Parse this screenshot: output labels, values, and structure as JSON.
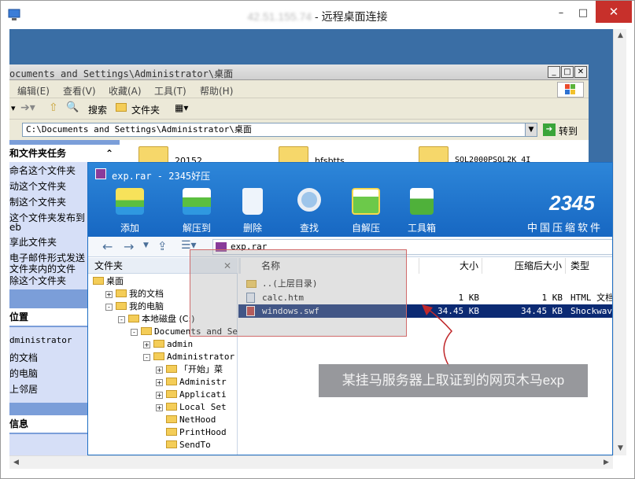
{
  "rdp": {
    "title_blurred": "42.51.155.74",
    "title_sep": " - ",
    "title": "远程桌面连接",
    "minimize": "–",
    "maximize": "□",
    "close": "✕"
  },
  "explorer": {
    "title": "ocuments and Settings\\Administrator\\桌面",
    "menu": [
      "编辑(E)",
      "查看(V)",
      "收藏(A)",
      "工具(T)",
      "帮助(H)"
    ],
    "toolbar": {
      "search": "搜索",
      "folders": "文件夹"
    },
    "address": "C:\\Documents and Settings\\Administrator\\桌面",
    "go_label": "转到",
    "folders": [
      "20152",
      "hfsbtts",
      "SQL2000PSQL2K_4I"
    ],
    "tasks_header": "和文件夹任务",
    "tasks": [
      "命名这个文件夹",
      "动这个文件夹",
      "制这个文件夹",
      "这个文件夹发布到",
      "eb",
      "享此文件夹",
      "电子邮件形式发送",
      "文件夹内的文件",
      "除这个文件夹"
    ],
    "places_header": "位置",
    "places": [
      "dministrator",
      "的文档",
      "的电脑",
      "上邻居"
    ],
    "details_header": "信息"
  },
  "haozip": {
    "title": "exp.rar - 2345好压",
    "brand": "2345",
    "tagline": "中国压缩软件第",
    "tools": [
      "添加",
      "解压到",
      "删除",
      "查找",
      "自解压",
      "工具箱"
    ],
    "path": "exp.rar",
    "tree_header": "文件夹",
    "tree": [
      {
        "label": "桌面",
        "indent": 0,
        "pm": ""
      },
      {
        "label": "我的文档",
        "indent": 1,
        "pm": "+"
      },
      {
        "label": "我的电脑",
        "indent": 1,
        "pm": "-"
      },
      {
        "label": "本地磁盘 (C:)",
        "indent": 2,
        "pm": "-"
      },
      {
        "label": "Documents and Se",
        "indent": 3,
        "pm": "-"
      },
      {
        "label": "admin",
        "indent": 4,
        "pm": "+"
      },
      {
        "label": "Administrator",
        "indent": 4,
        "pm": "-"
      },
      {
        "label": "「开始」菜",
        "indent": 5,
        "pm": "+"
      },
      {
        "label": "Administr",
        "indent": 5,
        "pm": "+"
      },
      {
        "label": "Applicati",
        "indent": 5,
        "pm": "+"
      },
      {
        "label": "Local Set",
        "indent": 5,
        "pm": "+"
      },
      {
        "label": "NetHood",
        "indent": 5,
        "pm": ""
      },
      {
        "label": "PrintHood",
        "indent": 5,
        "pm": ""
      },
      {
        "label": "SendTo",
        "indent": 5,
        "pm": ""
      }
    ],
    "columns": [
      "名称",
      "大小",
      "压缩后大小",
      "类型"
    ],
    "files": [
      {
        "name": "..(上层目录)",
        "size": "",
        "packed": "",
        "type": ""
      },
      {
        "name": "calc.htm",
        "size": "1 KB",
        "packed": "1 KB",
        "type": "HTML 文档"
      },
      {
        "name": "windows.swf",
        "size": "34.45 KB",
        "packed": "34.45 KB",
        "type": "Shockwave F"
      }
    ]
  },
  "caption": "某挂马服务器上取证到的网页木马exp",
  "colors": {
    "accent": "#1767c2",
    "selection": "#0c2a73",
    "annotation": "#c0282b"
  }
}
